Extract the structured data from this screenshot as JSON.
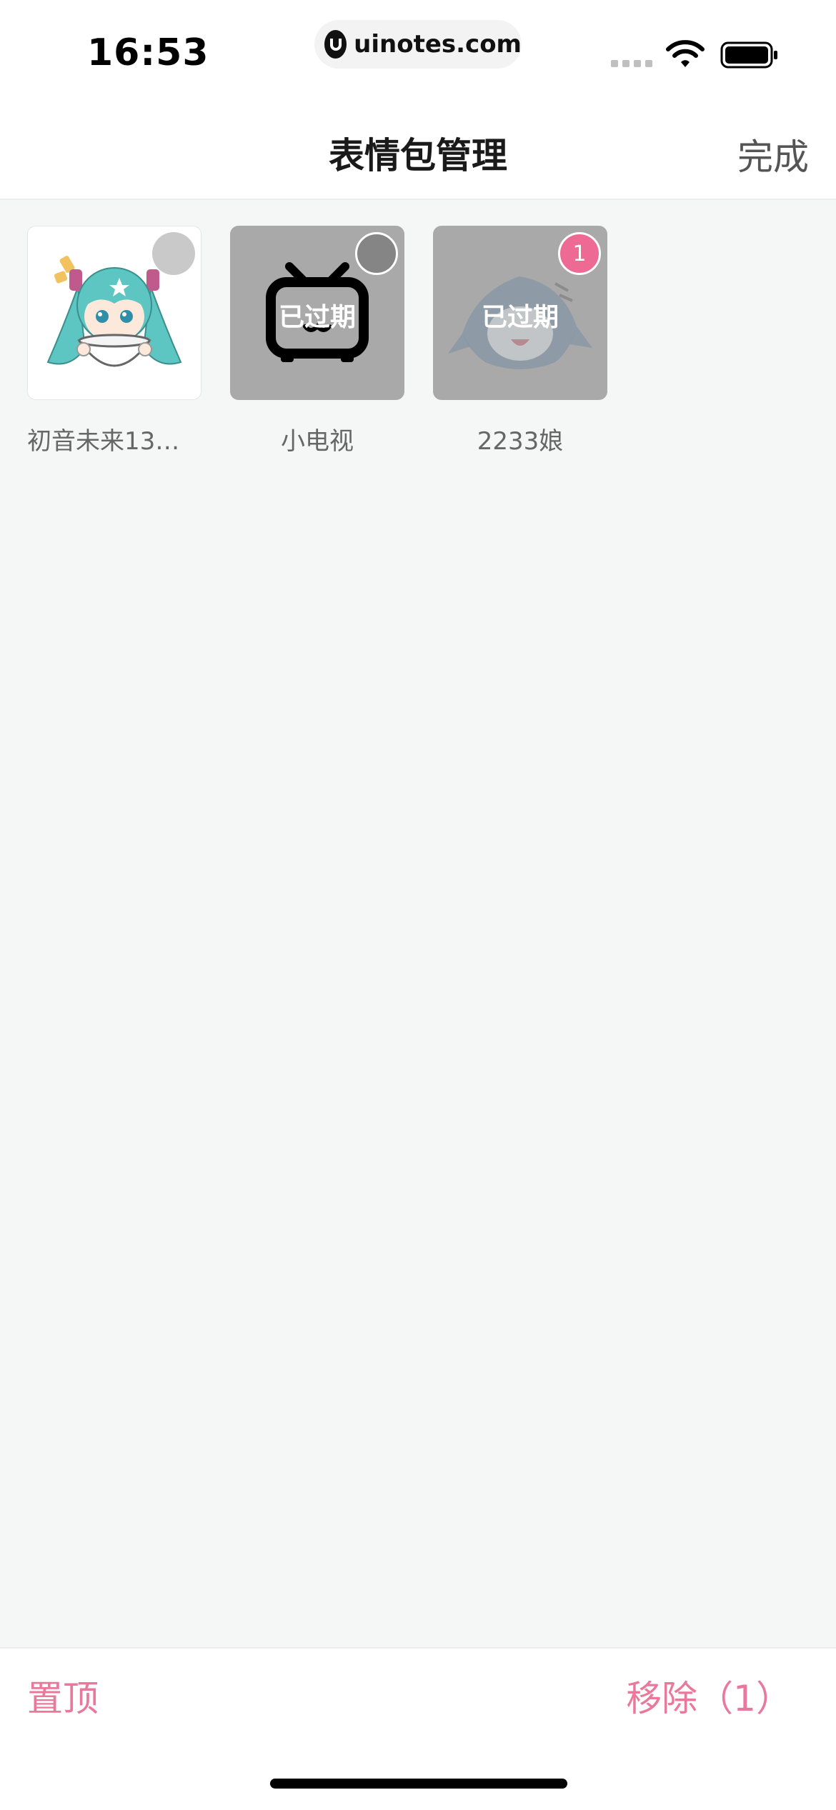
{
  "status_bar": {
    "time": "16:53",
    "url": "uinotes.com"
  },
  "nav": {
    "title": "表情包管理",
    "done_label": "完成"
  },
  "stickers": [
    {
      "name": "初音未来13…",
      "expired": false,
      "expired_label": "",
      "selected": false,
      "badge": ""
    },
    {
      "name": "小电视",
      "expired": true,
      "expired_label": "已过期",
      "selected": false,
      "badge": ""
    },
    {
      "name": "2233娘",
      "expired": true,
      "expired_label": "已过期",
      "selected": true,
      "badge": "1"
    }
  ],
  "bottom_bar": {
    "pin_label": "置顶",
    "remove_label": "移除（1）"
  },
  "colors": {
    "accent": "#e8799d",
    "badge": "#ec6a94",
    "background": "#f5f6f6"
  }
}
